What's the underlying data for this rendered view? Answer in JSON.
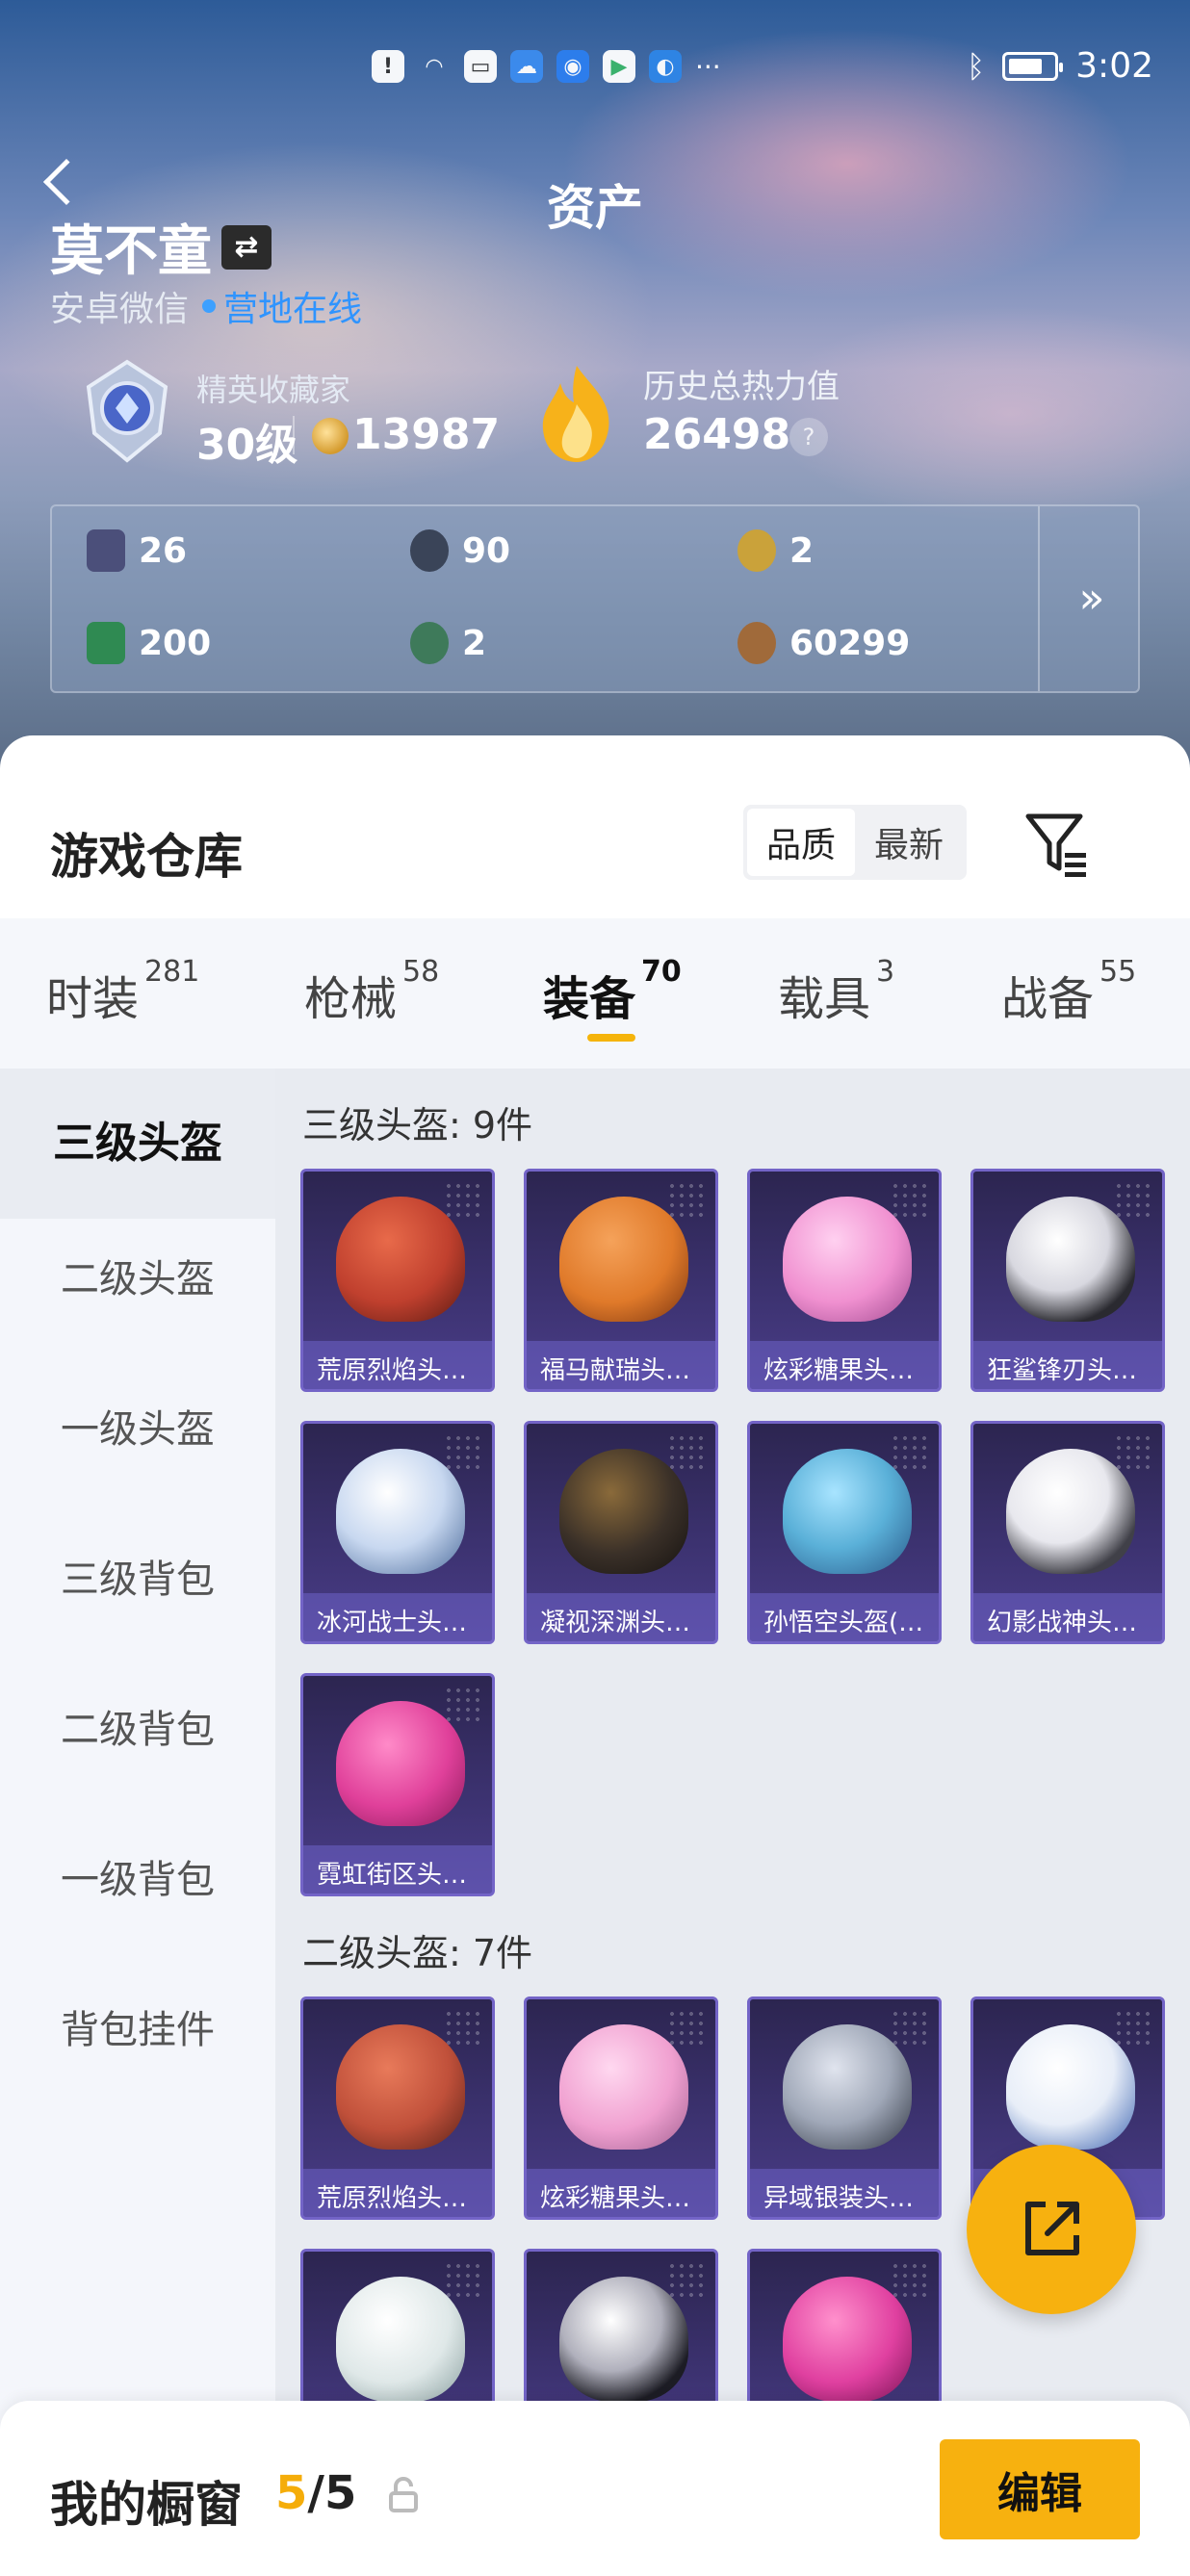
{
  "status_bar": {
    "time": "3:02",
    "icons": [
      "alert-icon",
      "wifi-icon",
      "message-icon",
      "cloud-icon",
      "bulb-icon",
      "store-icon",
      "browser-icon"
    ],
    "more": "···"
  },
  "nav": {
    "title": "资产"
  },
  "user": {
    "name": "莫不童",
    "switch_icon": "⇄",
    "platform": "安卓微信",
    "status": "营地在线"
  },
  "rank": {
    "title": "精英收藏家",
    "level": "30级",
    "coins": "13987"
  },
  "heat": {
    "title": "历史总热力值",
    "value": "26498",
    "help": "?"
  },
  "assets": [
    {
      "icon": "card-icon",
      "value": "26",
      "color": "#4b4f7a"
    },
    {
      "icon": "ring-icon",
      "value": "90",
      "color": "#3a4458"
    },
    {
      "icon": "gold-badge-icon",
      "value": "2",
      "color": "#caa23a"
    },
    {
      "icon": "green-card-icon",
      "value": "200",
      "color": "#2f8a52"
    },
    {
      "icon": "globe-icon",
      "value": "2",
      "color": "#3e7a5a"
    },
    {
      "icon": "coin-icon",
      "value": "60299",
      "color": "#a06a3a"
    }
  ],
  "assets_more": "»",
  "warehouse": {
    "title": "游戏仓库",
    "sort_options": [
      "品质",
      "最新"
    ]
  },
  "tabs": [
    {
      "label": "时装",
      "count": "281"
    },
    {
      "label": "枪械",
      "count": "58"
    },
    {
      "label": "装备",
      "count": "70"
    },
    {
      "label": "载具",
      "count": "3"
    },
    {
      "label": "战备",
      "count": "55"
    }
  ],
  "sidebar": [
    "三级头盔",
    "二级头盔",
    "一级头盔",
    "三级背包",
    "二级背包",
    "一级背包",
    "背包挂件"
  ],
  "sections": [
    {
      "title": "三级头盔: 9件",
      "items": [
        {
          "label": "荒原烈焰头…",
          "color": "#c0402e"
        },
        {
          "label": "福马献瑞头…",
          "color": "#e07a2a"
        },
        {
          "label": "炫彩糖果头…",
          "color": "#f090d0"
        },
        {
          "label": "狂鲨锋刃头…",
          "color": "#d8d8e0"
        },
        {
          "label": "冰河战士头…",
          "color": "#c8d8f0"
        },
        {
          "label": "凝视深渊头…",
          "color": "#3a3028"
        },
        {
          "label": "孙悟空头盔(…",
          "color": "#5ab0d8"
        },
        {
          "label": "幻影战神头…",
          "color": "#e8e8ee"
        },
        {
          "label": "霓虹街区头…",
          "color": "#e0409a"
        }
      ]
    },
    {
      "title": "二级头盔: 7件",
      "items": [
        {
          "label": "荒原烈焰头…",
          "color": "#c0503a"
        },
        {
          "label": "炫彩糖果头…",
          "color": "#f0a0d0"
        },
        {
          "label": "异域银装头…",
          "color": "#a0a8b8"
        },
        {
          "label": "",
          "color": "#e8eef8"
        },
        {
          "label": "",
          "color": "#dfe8e8"
        },
        {
          "label": "",
          "color": "#b0b0bc"
        },
        {
          "label": "",
          "color": "#e040a0"
        }
      ]
    }
  ],
  "showcase": {
    "title": "我的橱窗",
    "current": "5",
    "total": "/5",
    "edit_label": "编辑"
  }
}
